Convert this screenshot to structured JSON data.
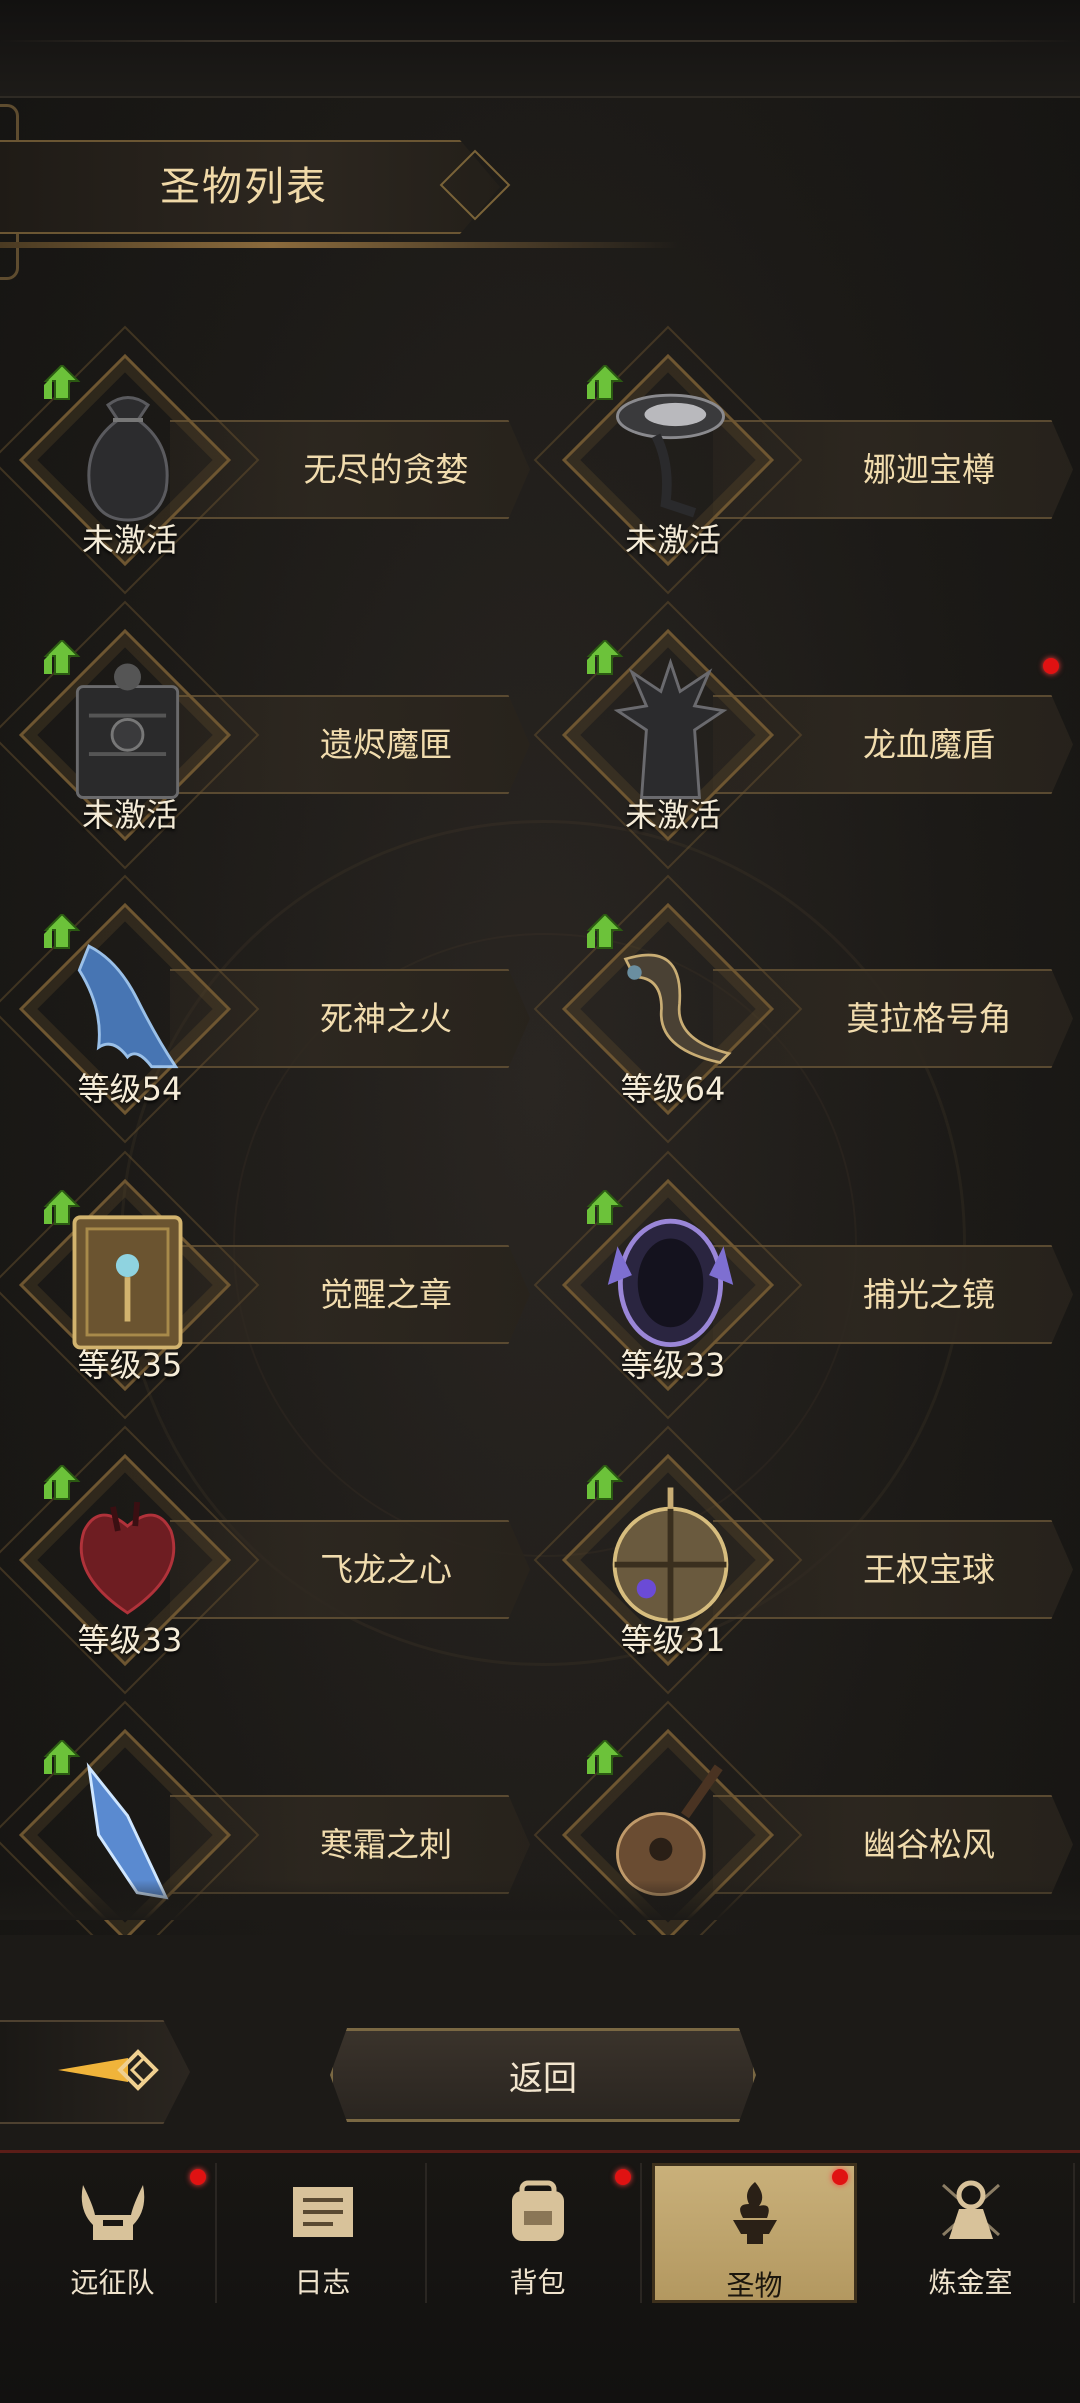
{
  "header": {
    "title": "圣物列表"
  },
  "relics": [
    {
      "name": "无尽的贪婪",
      "status": "未激活",
      "icon": "sack-icon",
      "red_dot": false
    },
    {
      "name": "娜迦宝樽",
      "status": "未激活",
      "icon": "chalice-icon",
      "red_dot": false
    },
    {
      "name": "遗烬魔匣",
      "status": "未激活",
      "icon": "box-icon",
      "red_dot": false
    },
    {
      "name": "龙血魔盾",
      "status": "未激活",
      "icon": "shield-icon",
      "red_dot": true
    },
    {
      "name": "死神之火",
      "status": "等级54",
      "icon": "blue-claw-icon",
      "red_dot": false
    },
    {
      "name": "莫拉格号角",
      "status": "等级64",
      "icon": "horn-icon",
      "red_dot": false
    },
    {
      "name": "觉醒之章",
      "status": "等级35",
      "icon": "book-icon",
      "red_dot": false
    },
    {
      "name": "捕光之镜",
      "status": "等级33",
      "icon": "mirror-icon",
      "red_dot": false
    },
    {
      "name": "飞龙之心",
      "status": "等级33",
      "icon": "heart-icon",
      "red_dot": false
    },
    {
      "name": "王权宝球",
      "status": "等级31",
      "icon": "orb-icon",
      "red_dot": false
    },
    {
      "name": "寒霜之刺",
      "status": "",
      "icon": "ice-shard-icon",
      "red_dot": false
    },
    {
      "name": "幽谷松风",
      "status": "",
      "icon": "lute-icon",
      "red_dot": false
    }
  ],
  "controls": {
    "return_label": "返回"
  },
  "nav": {
    "items": [
      {
        "label": "远征队",
        "icon": "horned-helmet-icon",
        "red_dot": true,
        "active": false
      },
      {
        "label": "日志",
        "icon": "scroll-icon",
        "red_dot": false,
        "active": false
      },
      {
        "label": "背包",
        "icon": "backpack-icon",
        "red_dot": true,
        "active": false
      },
      {
        "label": "圣物",
        "icon": "brazier-icon",
        "red_dot": true,
        "active": true
      },
      {
        "label": "炼金室",
        "icon": "alchemy-icon",
        "red_dot": false,
        "active": false
      }
    ]
  },
  "colors": {
    "accent_gold": "#e9d3a3",
    "notify_red": "#e01212",
    "upgrade_green": "#6cc23a"
  }
}
